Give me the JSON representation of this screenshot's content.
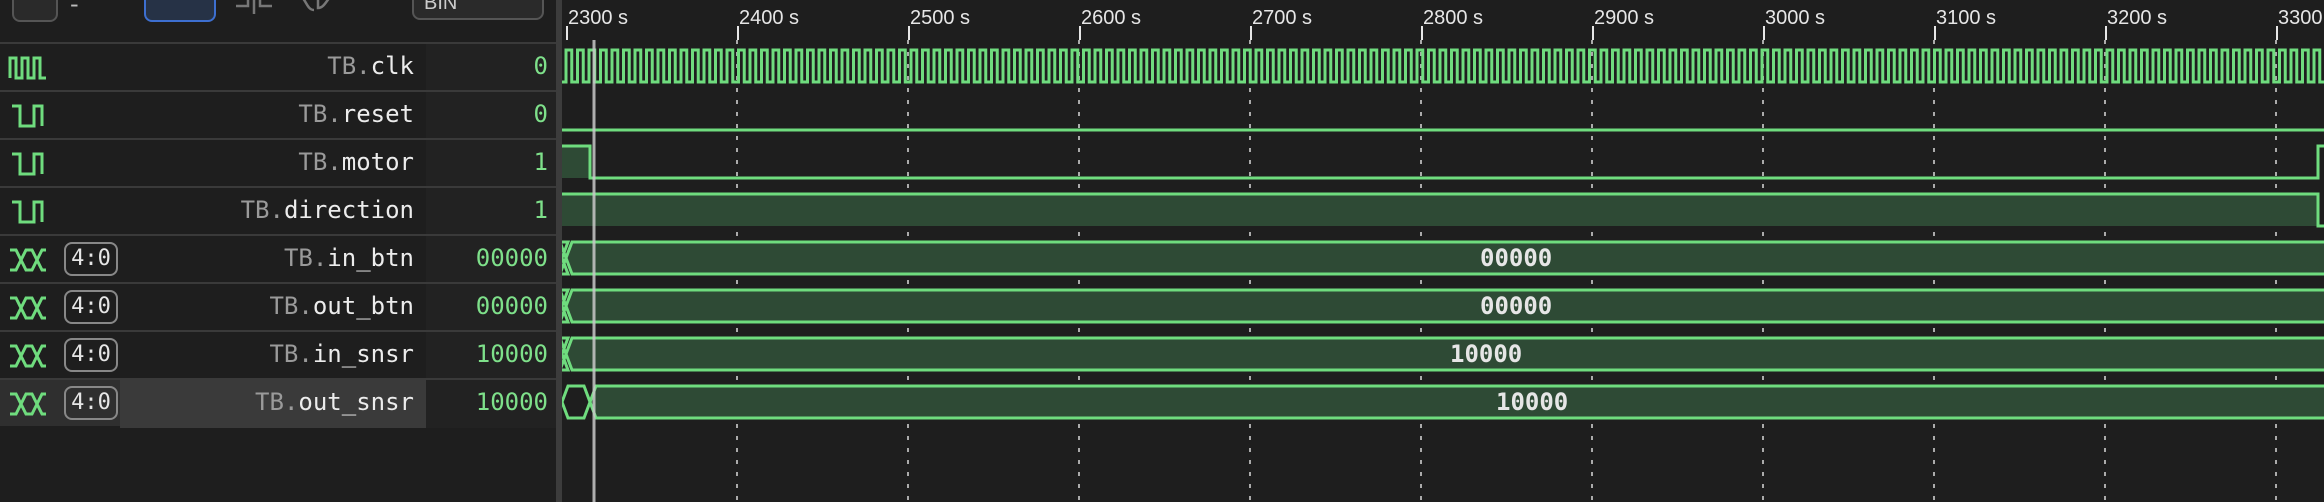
{
  "toolbar": {
    "minus_label": "-",
    "radix_select": "BIN"
  },
  "timeline": {
    "ticks": [
      "2300 s",
      "2400 s",
      "2500 s",
      "2600 s",
      "2700 s",
      "2800 s",
      "2900 s",
      "3000 s",
      "3100 s",
      "3200 s",
      "3300 s"
    ]
  },
  "signals": [
    {
      "scope": "TB.",
      "name": "clk",
      "value": "0",
      "type": "clock"
    },
    {
      "scope": "TB.",
      "name": "reset",
      "value": "0",
      "type": "bit"
    },
    {
      "scope": "TB.",
      "name": "motor",
      "value": "1",
      "type": "bit"
    },
    {
      "scope": "TB.",
      "name": "direction",
      "value": "1",
      "type": "bit"
    },
    {
      "scope": "TB.",
      "name": "in_btn",
      "value": "00000",
      "type": "bus",
      "range": "4:0",
      "wave_label": "00000"
    },
    {
      "scope": "TB.",
      "name": "out_btn",
      "value": "00000",
      "type": "bus",
      "range": "4:0",
      "wave_label": "00000"
    },
    {
      "scope": "TB.",
      "name": "in_snsr",
      "value": "10000",
      "type": "bus",
      "range": "4:0",
      "wave_label": "10000"
    },
    {
      "scope": "TB.",
      "name": "out_snsr",
      "value": "10000",
      "type": "bus",
      "range": "4:0",
      "wave_label": "10000"
    }
  ],
  "selected_signal": "out_snsr",
  "cursor_time": "2300 s",
  "colors": {
    "wave": "#6fdc7e",
    "wave_fill": "#2e4a35",
    "background": "#1e1e1e",
    "cursor": "#c8c8c8",
    "grid": "#cfcfcf"
  }
}
